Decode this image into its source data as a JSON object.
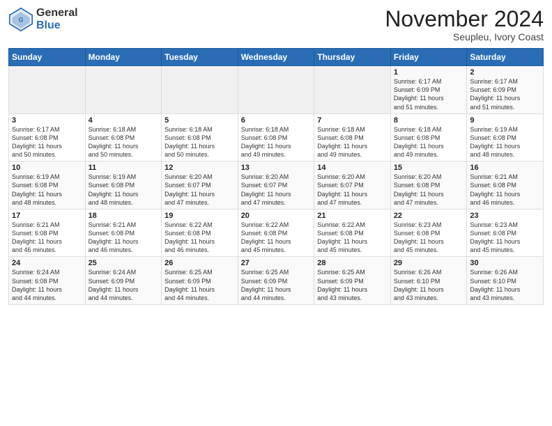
{
  "header": {
    "logo_general": "General",
    "logo_blue": "Blue",
    "month_title": "November 2024",
    "subtitle": "Seupleu, Ivory Coast"
  },
  "weekdays": [
    "Sunday",
    "Monday",
    "Tuesday",
    "Wednesday",
    "Thursday",
    "Friday",
    "Saturday"
  ],
  "weeks": [
    [
      {
        "day": "",
        "info": ""
      },
      {
        "day": "",
        "info": ""
      },
      {
        "day": "",
        "info": ""
      },
      {
        "day": "",
        "info": ""
      },
      {
        "day": "",
        "info": ""
      },
      {
        "day": "1",
        "info": "Sunrise: 6:17 AM\nSunset: 6:09 PM\nDaylight: 11 hours\nand 51 minutes."
      },
      {
        "day": "2",
        "info": "Sunrise: 6:17 AM\nSunset: 6:09 PM\nDaylight: 11 hours\nand 51 minutes."
      }
    ],
    [
      {
        "day": "3",
        "info": "Sunrise: 6:17 AM\nSunset: 6:08 PM\nDaylight: 11 hours\nand 50 minutes."
      },
      {
        "day": "4",
        "info": "Sunrise: 6:18 AM\nSunset: 6:08 PM\nDaylight: 11 hours\nand 50 minutes."
      },
      {
        "day": "5",
        "info": "Sunrise: 6:18 AM\nSunset: 6:08 PM\nDaylight: 11 hours\nand 50 minutes."
      },
      {
        "day": "6",
        "info": "Sunrise: 6:18 AM\nSunset: 6:08 PM\nDaylight: 11 hours\nand 49 minutes."
      },
      {
        "day": "7",
        "info": "Sunrise: 6:18 AM\nSunset: 6:08 PM\nDaylight: 11 hours\nand 49 minutes."
      },
      {
        "day": "8",
        "info": "Sunrise: 6:18 AM\nSunset: 6:08 PM\nDaylight: 11 hours\nand 49 minutes."
      },
      {
        "day": "9",
        "info": "Sunrise: 6:19 AM\nSunset: 6:08 PM\nDaylight: 11 hours\nand 48 minutes."
      }
    ],
    [
      {
        "day": "10",
        "info": "Sunrise: 6:19 AM\nSunset: 6:08 PM\nDaylight: 11 hours\nand 48 minutes."
      },
      {
        "day": "11",
        "info": "Sunrise: 6:19 AM\nSunset: 6:08 PM\nDaylight: 11 hours\nand 48 minutes."
      },
      {
        "day": "12",
        "info": "Sunrise: 6:20 AM\nSunset: 6:07 PM\nDaylight: 11 hours\nand 47 minutes."
      },
      {
        "day": "13",
        "info": "Sunrise: 6:20 AM\nSunset: 6:07 PM\nDaylight: 11 hours\nand 47 minutes."
      },
      {
        "day": "14",
        "info": "Sunrise: 6:20 AM\nSunset: 6:07 PM\nDaylight: 11 hours\nand 47 minutes."
      },
      {
        "day": "15",
        "info": "Sunrise: 6:20 AM\nSunset: 6:08 PM\nDaylight: 11 hours\nand 47 minutes."
      },
      {
        "day": "16",
        "info": "Sunrise: 6:21 AM\nSunset: 6:08 PM\nDaylight: 11 hours\nand 46 minutes."
      }
    ],
    [
      {
        "day": "17",
        "info": "Sunrise: 6:21 AM\nSunset: 6:08 PM\nDaylight: 11 hours\nand 46 minutes."
      },
      {
        "day": "18",
        "info": "Sunrise: 6:21 AM\nSunset: 6:08 PM\nDaylight: 11 hours\nand 46 minutes."
      },
      {
        "day": "19",
        "info": "Sunrise: 6:22 AM\nSunset: 6:08 PM\nDaylight: 11 hours\nand 46 minutes."
      },
      {
        "day": "20",
        "info": "Sunrise: 6:22 AM\nSunset: 6:08 PM\nDaylight: 11 hours\nand 45 minutes."
      },
      {
        "day": "21",
        "info": "Sunrise: 6:22 AM\nSunset: 6:08 PM\nDaylight: 11 hours\nand 45 minutes."
      },
      {
        "day": "22",
        "info": "Sunrise: 6:23 AM\nSunset: 6:08 PM\nDaylight: 11 hours\nand 45 minutes."
      },
      {
        "day": "23",
        "info": "Sunrise: 6:23 AM\nSunset: 6:08 PM\nDaylight: 11 hours\nand 45 minutes."
      }
    ],
    [
      {
        "day": "24",
        "info": "Sunrise: 6:24 AM\nSunset: 6:08 PM\nDaylight: 11 hours\nand 44 minutes."
      },
      {
        "day": "25",
        "info": "Sunrise: 6:24 AM\nSunset: 6:09 PM\nDaylight: 11 hours\nand 44 minutes."
      },
      {
        "day": "26",
        "info": "Sunrise: 6:25 AM\nSunset: 6:09 PM\nDaylight: 11 hours\nand 44 minutes."
      },
      {
        "day": "27",
        "info": "Sunrise: 6:25 AM\nSunset: 6:09 PM\nDaylight: 11 hours\nand 44 minutes."
      },
      {
        "day": "28",
        "info": "Sunrise: 6:25 AM\nSunset: 6:09 PM\nDaylight: 11 hours\nand 43 minutes."
      },
      {
        "day": "29",
        "info": "Sunrise: 6:26 AM\nSunset: 6:10 PM\nDaylight: 11 hours\nand 43 minutes."
      },
      {
        "day": "30",
        "info": "Sunrise: 6:26 AM\nSunset: 6:10 PM\nDaylight: 11 hours\nand 43 minutes."
      }
    ]
  ]
}
